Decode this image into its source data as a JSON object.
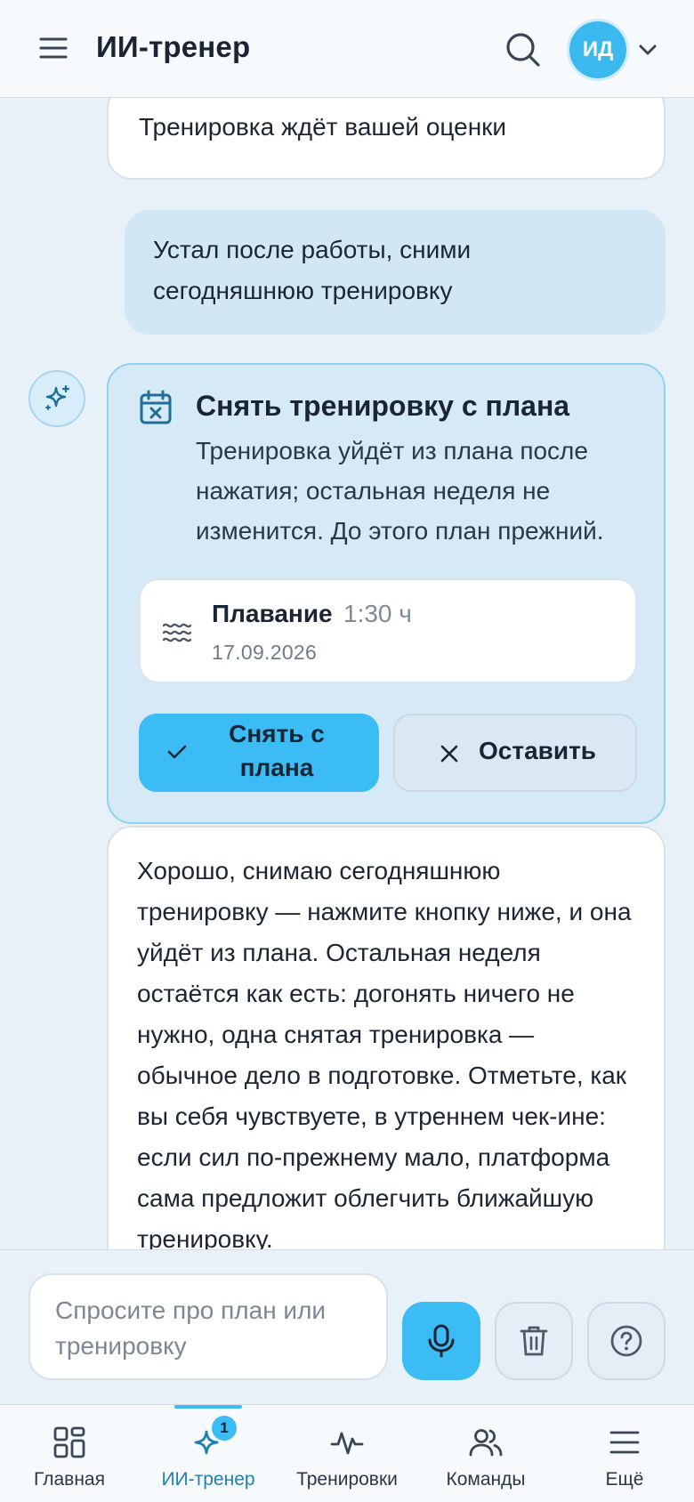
{
  "header": {
    "title": "ИИ-тренер",
    "avatar_initials": "ИД",
    "icons": [
      "menu-icon",
      "search-icon",
      "chevron-down-icon"
    ]
  },
  "chat": {
    "partial_message": "Тренировка ждёт вашей оценки",
    "user_message": "Устал после работы, сними сегодняшнюю тренировку",
    "action_card": {
      "icon": "calendar-x-icon",
      "title": "Снять тренировку с плана",
      "description": "Тренировка уйдёт из плана после нажатия; остальная неделя не изменится. До этого план прежний.",
      "workout": {
        "icon": "water-waves-icon",
        "name": "Плавание",
        "duration": "1:30 ч",
        "date": "17.09.2026"
      },
      "confirm_label": "Снять с плана",
      "keep_label": "Оставить"
    },
    "assistant_message": "Хорошо, снимаю сегодняшнюю тренировку — нажмите кнопку ниже, и она уйдёт из плана. Остальная неделя остаётся как есть: догонять ничего не нужно, одна снятая тренировка — обычное дело в подготовке. Отметьте, как вы себя чувствуете, в утреннем чек-ине: если сил по-прежнему мало, платформа сама предложит облегчить ближайшую тренировку."
  },
  "composer": {
    "placeholder": "Спросите про план или тренировку"
  },
  "nav": {
    "items": [
      {
        "label": "Главная",
        "icon": "grid-icon"
      },
      {
        "label": "ИИ-тренер",
        "icon": "sparkle-icon",
        "badge": "1",
        "active": true
      },
      {
        "label": "Тренировки",
        "icon": "activity-icon"
      },
      {
        "label": "Команды",
        "icon": "users-icon"
      },
      {
        "label": "Ещё",
        "icon": "menu-icon"
      }
    ]
  },
  "colors": {
    "accent": "#3bbcf4",
    "background": "#e9f1f8",
    "card_bg": "#d6e9f7",
    "user_bubble": "#d2e7f6"
  }
}
